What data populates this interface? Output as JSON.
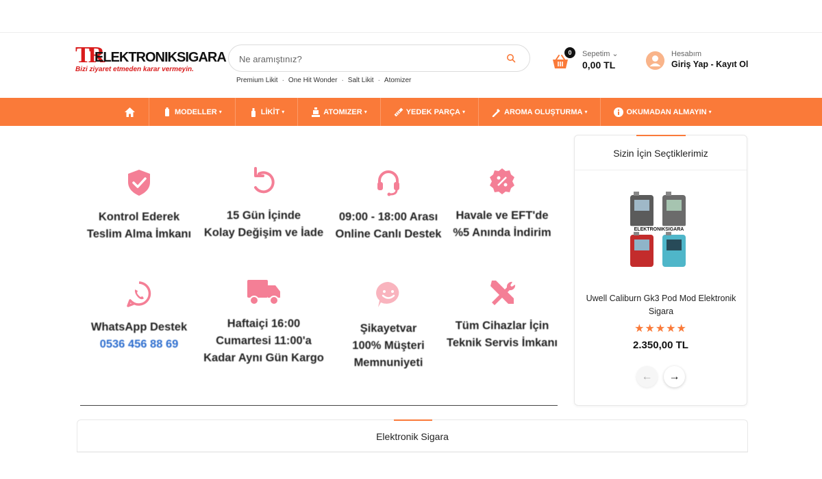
{
  "header": {
    "logo": {
      "mark": "TR",
      "name": "ELEKTRONIKSIGARA",
      "slogan": "Bizi ziyaret etmeden karar vermeyin."
    },
    "search": {
      "placeholder": "Ne aramıştınız?"
    },
    "quick_links": [
      "Premium Likit",
      "One Hit Wonder",
      "Salt Likit",
      "Atomizer"
    ],
    "cart": {
      "count": "0",
      "label": "Sepetim",
      "total": "0,00 TL"
    },
    "account": {
      "label": "Hesabım",
      "login": "Giriş Yap",
      "separator": "-",
      "register": "Kayıt Ol"
    }
  },
  "nav": {
    "items": [
      {
        "label": "MODELLER",
        "icon": "device-icon"
      },
      {
        "label": "LİKİT",
        "icon": "bottle-icon"
      },
      {
        "label": "ATOMIZER",
        "icon": "atomizer-icon"
      },
      {
        "label": "YEDEK PARÇA",
        "icon": "coil-icon"
      },
      {
        "label": "AROMA OLUŞTURMA",
        "icon": "dropper-icon"
      },
      {
        "label": "OKUMADAN ALMAYIN",
        "icon": "info-icon"
      }
    ]
  },
  "features": [
    {
      "icon": "shield-check-icon",
      "lines": [
        "Kontrol Ederek",
        "Teslim Alma İmkanı"
      ]
    },
    {
      "icon": "return-icon",
      "lines": [
        "15 Gün İçinde",
        "Kolay Değişim ve İade"
      ]
    },
    {
      "icon": "headset-icon",
      "lines": [
        "09:00 - 18:00 Arası",
        "Online Canlı Destek"
      ]
    },
    {
      "icon": "percent-badge-icon",
      "lines": [
        "Havale ve EFT'de",
        "%5 Anında İndirim"
      ]
    },
    {
      "icon": "whatsapp-icon",
      "lines": [
        "WhatsApp Destek"
      ],
      "phone": "0536 456 88 69"
    },
    {
      "icon": "truck-icon",
      "lines": [
        "Haftaiçi 16:00",
        "Cumartesi 11:00'a",
        "Kadar Aynı Gün Kargo"
      ]
    },
    {
      "icon": "smile-chat-icon",
      "lines": [
        "Şikayetvar",
        "100% Müşteri",
        "Memnuniyeti"
      ]
    },
    {
      "icon": "tools-icon",
      "lines": [
        "Tüm Cihazlar İçin",
        "Teknik Servis İmkanı"
      ]
    }
  ],
  "picks": {
    "title": "Sizin İçin Seçtiklerimiz",
    "product": {
      "name": "Uwell Caliburn Gk3 Pod Mod Elektronik Sigara",
      "rating": 5,
      "stars": "★★★★★",
      "price": "2.350,00 TL",
      "image_text": "ELEKTRONIKSIGARA"
    },
    "prev": "←",
    "next": "→"
  },
  "section": {
    "title": "Elektronik Sigara"
  },
  "colors": {
    "accent": "#fa7a39",
    "icon_pink": "#f07b91",
    "phone_blue": "#2f6fcf"
  }
}
